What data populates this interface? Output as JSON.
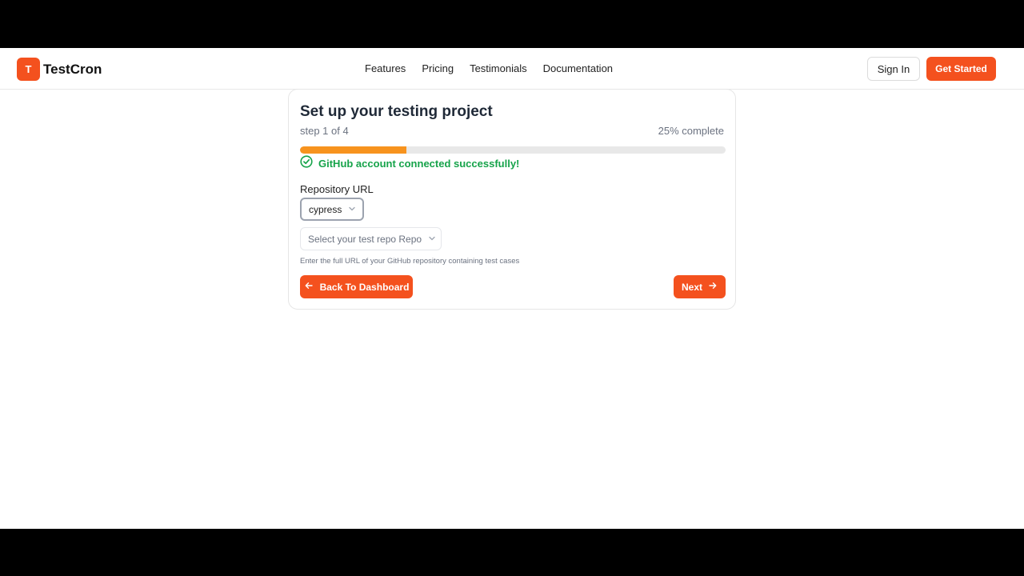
{
  "brand": {
    "logo_letter": "T",
    "name": "TestCron",
    "accent": "#f4511e"
  },
  "nav": {
    "items": [
      {
        "label": "Features"
      },
      {
        "label": "Pricing"
      },
      {
        "label": "Testimonials"
      },
      {
        "label": "Documentation"
      }
    ]
  },
  "auth": {
    "sign_in": "Sign In",
    "get_started": "Get Started"
  },
  "wizard": {
    "title": "Set up your testing project",
    "step": "step 1 of 4",
    "percent_text": "25% complete",
    "progress_fraction": 0.25,
    "progress_color": "#f7931e",
    "success_message": "GitHub account connected successfully!",
    "success_icon": "check-circle-icon",
    "success_color": "#16a34a",
    "repo_label": "Repository URL",
    "framework_value": "cypress",
    "repo_placeholder": "Select your test repo Repo",
    "helper_text": "Enter the full URL of your GitHub repository containing test cases",
    "back_label": "Back To Dashboard",
    "back_icon": "arrow-left-icon",
    "next_label": "Next",
    "next_icon": "arrow-right-icon"
  }
}
